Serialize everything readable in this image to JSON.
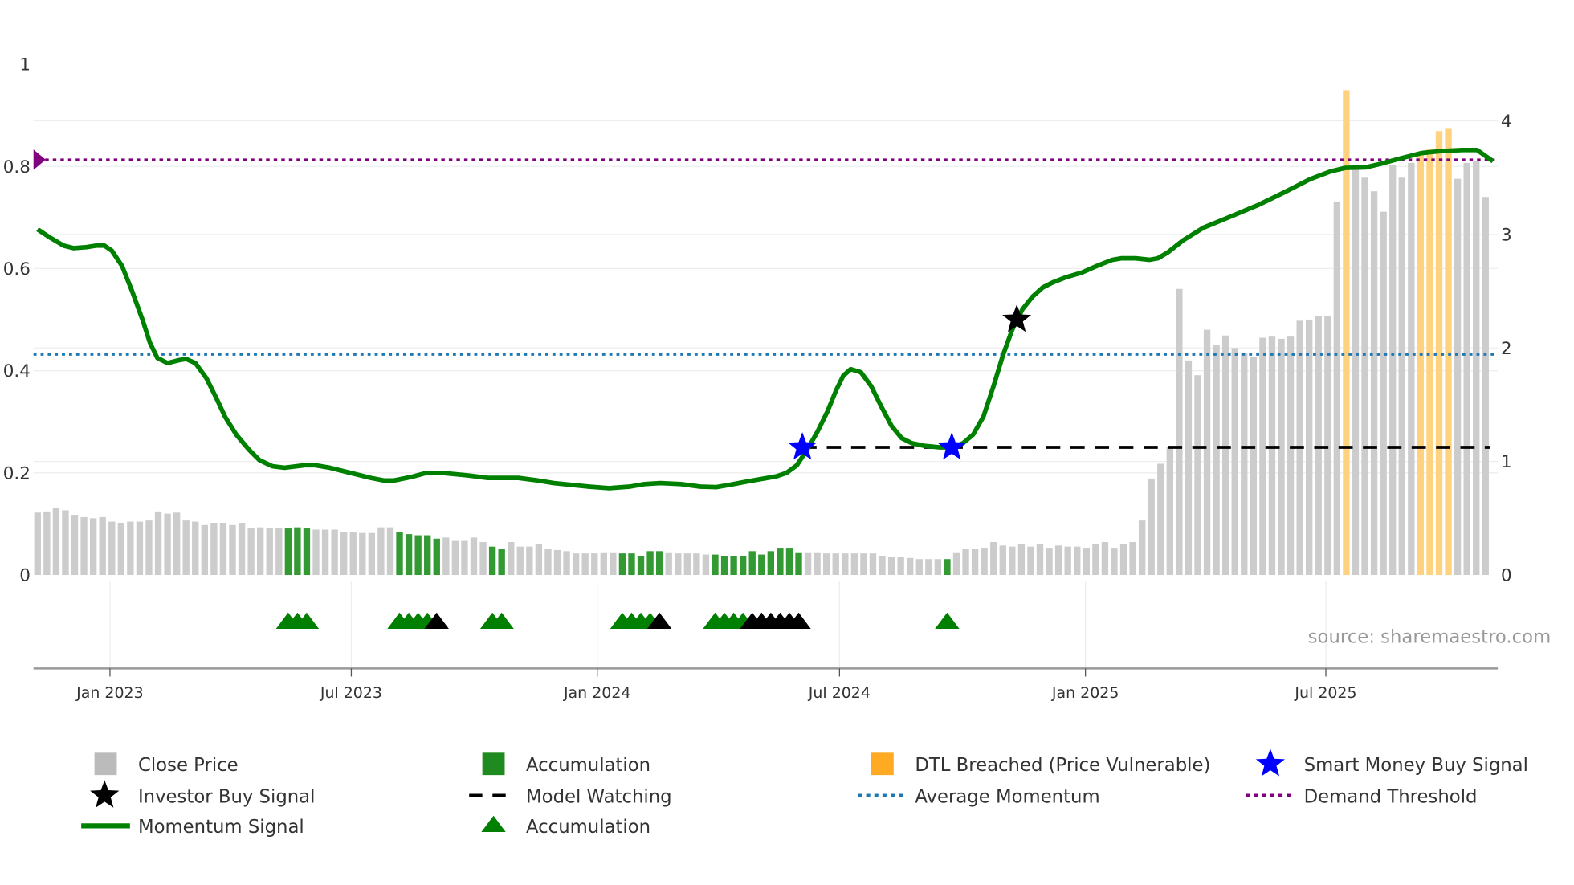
{
  "chart_data": {
    "type": "bar+line",
    "x_unit": "week index (weekly bars)",
    "left_axis": {
      "ylim": [
        0,
        1
      ],
      "ticks": [
        "0",
        "0.2",
        "0.4",
        "0.6",
        "0.8",
        "1"
      ],
      "tick_values": [
        0,
        0.2,
        0.4,
        0.6,
        0.8,
        1
      ]
    },
    "right_axis": {
      "ylim": [
        0,
        4.3
      ],
      "ticks": [
        "0",
        "1",
        "2",
        "3",
        "4"
      ],
      "tick_values": [
        0,
        1,
        2,
        3,
        4
      ]
    },
    "x_ticks": [
      {
        "label": "Jan 2023",
        "week": 7.8
      },
      {
        "label": "Jul 2023",
        "week": 33.8
      },
      {
        "label": "Jan 2024",
        "week": 60.3
      },
      {
        "label": "Jul 2024",
        "week": 86.4
      },
      {
        "label": "Jan 2025",
        "week": 112.9
      },
      {
        "label": "Jul 2025",
        "week": 138.8
      }
    ],
    "close_price": [
      0.55,
      0.56,
      0.59,
      0.57,
      0.53,
      0.51,
      0.5,
      0.51,
      0.47,
      0.46,
      0.47,
      0.47,
      0.48,
      0.56,
      0.54,
      0.55,
      0.48,
      0.47,
      0.44,
      0.46,
      0.46,
      0.44,
      0.46,
      0.41,
      0.42,
      0.41,
      0.41,
      0.41,
      0.42,
      0.41,
      0.4,
      0.4,
      0.4,
      0.38,
      0.38,
      0.37,
      0.37,
      0.42,
      0.42,
      0.38,
      0.36,
      0.35,
      0.35,
      0.32,
      0.33,
      0.3,
      0.3,
      0.33,
      0.29,
      0.25,
      0.23,
      0.29,
      0.25,
      0.25,
      0.27,
      0.23,
      0.22,
      0.21,
      0.19,
      0.19,
      0.19,
      0.2,
      0.2,
      0.19,
      0.19,
      0.17,
      0.21,
      0.21,
      0.2,
      0.19,
      0.19,
      0.19,
      0.18,
      0.18,
      0.17,
      0.17,
      0.17,
      0.21,
      0.18,
      0.21,
      0.24,
      0.24,
      0.2,
      0.2,
      0.2,
      0.19,
      0.19,
      0.19,
      0.19,
      0.19,
      0.19,
      0.17,
      0.16,
      0.16,
      0.15,
      0.14,
      0.14,
      0.14,
      0.14,
      0.2,
      0.23,
      0.23,
      0.24,
      0.29,
      0.26,
      0.25,
      0.27,
      0.25,
      0.27,
      0.24,
      0.26,
      0.25,
      0.25,
      0.24,
      0.27,
      0.29,
      0.24,
      0.27,
      0.29,
      0.48,
      0.85,
      0.98,
      1.13,
      2.52,
      1.89,
      1.76,
      2.16,
      2.03,
      2.11,
      2.0,
      1.96,
      1.92,
      2.09,
      2.1,
      2.08,
      2.1,
      2.24,
      2.25,
      2.28,
      2.28,
      3.29,
      4.27,
      3.61,
      3.5,
      3.38,
      3.2,
      3.61,
      3.5,
      3.63,
      3.72,
      3.75,
      3.91,
      3.93,
      3.49,
      3.63,
      3.65,
      3.33
    ],
    "accumulation_bar_weeks": [
      27,
      28,
      29,
      39,
      40,
      41,
      42,
      43,
      49,
      50,
      63,
      64,
      65,
      66,
      67,
      73,
      74,
      75,
      76,
      77,
      78,
      79,
      80,
      81,
      82,
      98
    ],
    "dtl_breached_weeks": [
      141,
      149,
      150,
      151,
      152
    ],
    "momentum_signal": [
      [
        0,
        0.677
      ],
      [
        1.4,
        0.66
      ],
      [
        2.8,
        0.645
      ],
      [
        3.9,
        0.64
      ],
      [
        5.3,
        0.642
      ],
      [
        6.3,
        0.645
      ],
      [
        7.2,
        0.645
      ],
      [
        8.0,
        0.635
      ],
      [
        9.1,
        0.605
      ],
      [
        10.2,
        0.555
      ],
      [
        11.3,
        0.5
      ],
      [
        12.1,
        0.455
      ],
      [
        12.9,
        0.425
      ],
      [
        14.0,
        0.415
      ],
      [
        15.1,
        0.42
      ],
      [
        16.0,
        0.423
      ],
      [
        17.0,
        0.415
      ],
      [
        18.2,
        0.385
      ],
      [
        19.3,
        0.345
      ],
      [
        20.2,
        0.31
      ],
      [
        21.4,
        0.275
      ],
      [
        22.8,
        0.245
      ],
      [
        23.9,
        0.225
      ],
      [
        25.3,
        0.213
      ],
      [
        26.6,
        0.21
      ],
      [
        28.8,
        0.215
      ],
      [
        29.9,
        0.215
      ],
      [
        31.5,
        0.21
      ],
      [
        33.7,
        0.2
      ],
      [
        35.9,
        0.19
      ],
      [
        37.3,
        0.185
      ],
      [
        38.4,
        0.185
      ],
      [
        40.3,
        0.192
      ],
      [
        41.9,
        0.2
      ],
      [
        43.5,
        0.2
      ],
      [
        46.3,
        0.195
      ],
      [
        48.5,
        0.19
      ],
      [
        51.8,
        0.19
      ],
      [
        53.9,
        0.185
      ],
      [
        55.6,
        0.18
      ],
      [
        57.2,
        0.177
      ],
      [
        59.4,
        0.173
      ],
      [
        61.6,
        0.17
      ],
      [
        63.8,
        0.173
      ],
      [
        65.4,
        0.178
      ],
      [
        67.1,
        0.18
      ],
      [
        69.3,
        0.178
      ],
      [
        71.4,
        0.173
      ],
      [
        73.1,
        0.172
      ],
      [
        74.7,
        0.177
      ],
      [
        76.4,
        0.183
      ],
      [
        78.0,
        0.188
      ],
      [
        79.6,
        0.193
      ],
      [
        80.7,
        0.2
      ],
      [
        81.8,
        0.215
      ],
      [
        82.9,
        0.245
      ],
      [
        84.0,
        0.28
      ],
      [
        85.1,
        0.32
      ],
      [
        86.0,
        0.36
      ],
      [
        86.8,
        0.39
      ],
      [
        87.6,
        0.403
      ],
      [
        88.7,
        0.397
      ],
      [
        89.8,
        0.37
      ],
      [
        90.9,
        0.33
      ],
      [
        92.0,
        0.292
      ],
      [
        93.1,
        0.268
      ],
      [
        94.2,
        0.258
      ],
      [
        95.5,
        0.253
      ],
      [
        97.2,
        0.25
      ],
      [
        98.6,
        0.25
      ],
      [
        99.7,
        0.258
      ],
      [
        100.8,
        0.275
      ],
      [
        101.9,
        0.31
      ],
      [
        103.0,
        0.37
      ],
      [
        104.0,
        0.43
      ],
      [
        105.0,
        0.48
      ],
      [
        106.1,
        0.52
      ],
      [
        107.2,
        0.545
      ],
      [
        108.3,
        0.563
      ],
      [
        109.4,
        0.573
      ],
      [
        110.8,
        0.583
      ],
      [
        112.5,
        0.592
      ],
      [
        114.1,
        0.605
      ],
      [
        115.8,
        0.617
      ],
      [
        116.8,
        0.62
      ],
      [
        118.3,
        0.62
      ],
      [
        119.8,
        0.617
      ],
      [
        120.7,
        0.62
      ],
      [
        121.8,
        0.632
      ],
      [
        123.4,
        0.655
      ],
      [
        125.6,
        0.68
      ],
      [
        128.3,
        0.7
      ],
      [
        131.6,
        0.725
      ],
      [
        134.4,
        0.75
      ],
      [
        137.1,
        0.775
      ],
      [
        139.3,
        0.79
      ],
      [
        140.9,
        0.797
      ],
      [
        143.1,
        0.798
      ],
      [
        144.7,
        0.805
      ],
      [
        146.9,
        0.816
      ],
      [
        149.1,
        0.826
      ],
      [
        151.3,
        0.83
      ],
      [
        153.5,
        0.832
      ],
      [
        155.1,
        0.832
      ],
      [
        156.8,
        0.81
      ]
    ],
    "average_momentum": 0.432,
    "demand_threshold": 0.813,
    "model_watching": {
      "from_week": 82.4,
      "to_week": 156.5,
      "value": 0.25
    },
    "smart_money_buy_signals": [
      [
        82.4,
        0.25
      ],
      [
        98.5,
        0.25
      ]
    ],
    "investor_buy_signals": [
      [
        105.5,
        0.5
      ]
    ],
    "accumulation_markers": [
      27,
      28,
      29,
      39,
      40,
      41,
      42,
      49,
      50,
      63,
      64,
      65,
      66,
      73,
      74,
      75,
      76,
      98
    ],
    "accumulation_markers_black": [
      43,
      67,
      77,
      78,
      79,
      80,
      81,
      82
    ],
    "colors": {
      "close": "#cccccc",
      "accum_bar": "#339933",
      "dtl": "#ffd280",
      "momentum": "#008000",
      "avg": "#1f77b4",
      "threshold": "#800080",
      "smart": "#0000ff",
      "investor": "#000000",
      "watching": "#000000"
    },
    "legend": [
      {
        "label": "Close Price",
        "symbol": "gray-square"
      },
      {
        "label": "Accumulation",
        "symbol": "green-square"
      },
      {
        "label": "DTL Breached (Price Vulnerable)",
        "symbol": "orange-square"
      },
      {
        "label": "Smart Money Buy Signal",
        "symbol": "blue-star"
      },
      {
        "label": "Investor Buy Signal",
        "symbol": "black-star"
      },
      {
        "label": "Model Watching",
        "symbol": "black-dash"
      },
      {
        "label": "Average Momentum",
        "symbol": "blue-dot"
      },
      {
        "label": "Demand Threshold",
        "symbol": "purple-dot"
      },
      {
        "label": "Momentum Signal",
        "symbol": "green-line"
      },
      {
        "label": "Accumulation",
        "symbol": "green-triangle"
      }
    ],
    "source": "source: sharemaestro.com"
  }
}
